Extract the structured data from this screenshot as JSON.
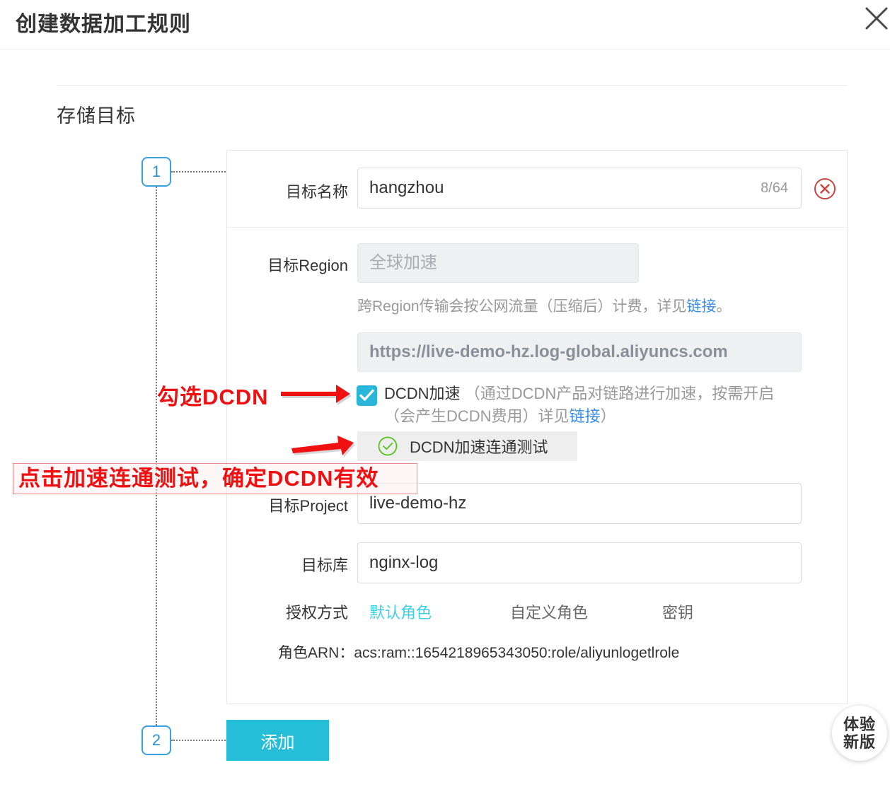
{
  "dialog": {
    "title": "创建数据加工规则",
    "close_icon": "close-icon"
  },
  "section": {
    "title": "存储目标"
  },
  "steps": [
    {
      "number": "1"
    },
    {
      "number": "2"
    }
  ],
  "form": {
    "name_label": "目标名称",
    "name_value": "hangzhou",
    "name_counter": "8/64",
    "delete_icon": "circle-x-icon",
    "region_label": "目标Region",
    "region_value": "全球加速",
    "region_helper_prefix": "跨Region传输会按公网流量（压缩后）计费，详见",
    "region_helper_link": "链接",
    "region_helper_suffix": "。",
    "endpoint_value": "https://live-demo-hz.log-global.aliyuncs.com",
    "dcdn_checkbox_label": "DCDN加速",
    "dcdn_desc_part1": "（通过DCDN产品对链路进行加速，按需开启（会产生DCDN费用）详见",
    "dcdn_desc_link": "链接",
    "dcdn_desc_part2": "）",
    "dcdn_test_label": "DCDN加速连通测试",
    "dcdn_test_icon": "check-circle-icon",
    "project_label": "目标Project",
    "project_value": "live-demo-hz",
    "logstore_label": "目标库",
    "logstore_value": "nginx-log",
    "auth_label": "授权方式",
    "auth_options": [
      {
        "label": "默认角色",
        "selected": true
      },
      {
        "label": "自定义角色",
        "selected": false
      },
      {
        "label": "密钥",
        "selected": false
      }
    ],
    "arn_label": "角色ARN：",
    "arn_value": "acs:ram::1654218965343050:role/aliyunlogetlrole"
  },
  "actions": {
    "add_label": "添加"
  },
  "annotations": {
    "note1": "勾选DCDN",
    "note2": "点击加速连通测试，确定DCDN有效",
    "arrow_icon": "right-arrow-icon"
  },
  "fab": {
    "line1": "体验",
    "line2": "新版"
  },
  "colors": {
    "accent": "#26bdd8",
    "checkbox": "#29b6d8",
    "link": "#3a8ee6",
    "annotation_red": "#ef1111",
    "success_green": "#52c41a",
    "step_blue": "#3aa0dd",
    "delete_red": "#c9443f"
  }
}
